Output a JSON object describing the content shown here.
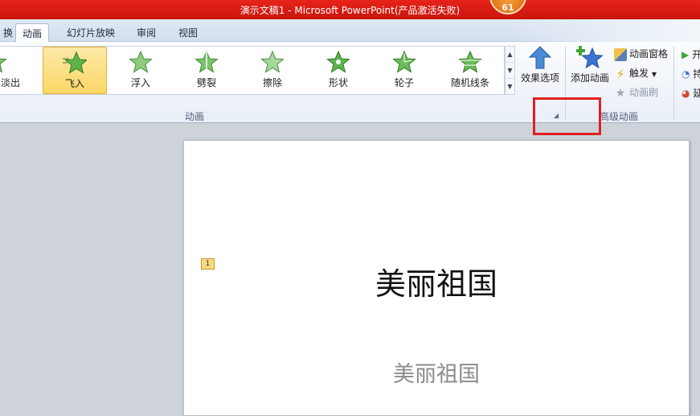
{
  "window": {
    "title": "演示文稿1 - Microsoft PowerPoint(产品激活失败)",
    "badge": "61"
  },
  "tabs": [
    {
      "label": "换"
    },
    {
      "label": "动画"
    },
    {
      "label": "幻灯片放映"
    },
    {
      "label": "审阅"
    },
    {
      "label": "视图"
    }
  ],
  "ribbon": {
    "animations": [
      {
        "label": "淡出"
      },
      {
        "label": "飞入"
      },
      {
        "label": "浮入"
      },
      {
        "label": "劈裂"
      },
      {
        "label": "擦除"
      },
      {
        "label": "形状"
      },
      {
        "label": "轮子"
      },
      {
        "label": "随机线条"
      }
    ],
    "effect_options": "效果选项",
    "add_animation": "添加动画",
    "animation_pane": "动画窗格",
    "trigger": "触发",
    "animation_painter": "动画刷",
    "group_animation": "动画",
    "group_advanced": "高级动画",
    "timing_labels": [
      "开",
      "持",
      "延"
    ]
  },
  "colors": {
    "accent_red": "#e02020",
    "selected": "#fbd766"
  },
  "slide": {
    "animation_tag": "1",
    "title": "美丽祖国",
    "subtitle": "美丽祖国"
  }
}
